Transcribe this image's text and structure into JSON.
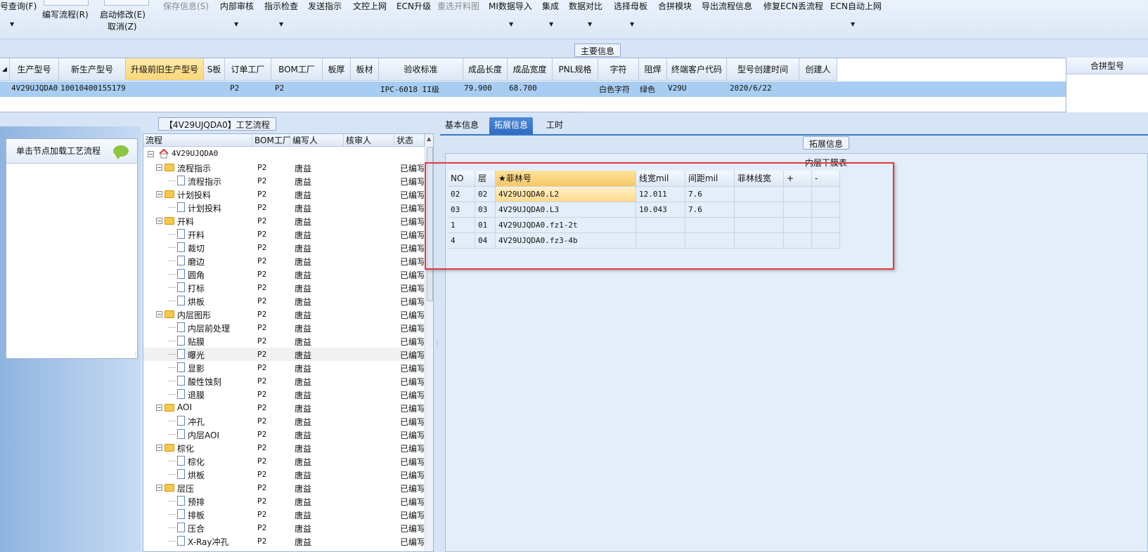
{
  "toolbar": {
    "query": "号查询(F)",
    "write_flow": "编写流程(R)",
    "start_modify": "启动修改(E)",
    "cancel": "取消(Z)",
    "save": "保存信息(S)",
    "internal_review": "内部审核",
    "instruction_check": "指示检查",
    "send_instruction": "发送指示",
    "doc_upload": "文控上网",
    "ecn_upgrade": "ECN升级",
    "reselect": "重选开料图",
    "mi_import": "MI数据导入",
    "integrate": "集成",
    "data_compare": "数据对比",
    "select_motherboard": "选择母板",
    "merge_module": "合拼模块",
    "export_flow": "导出流程信息",
    "fix_ecn": "修复ECN丢流程",
    "ecn_auto": "ECN自动上网"
  },
  "main_info": {
    "title": "主要信息",
    "headers": [
      "生产型号",
      "新生产型号",
      "升级前旧生产型号",
      "S板",
      "订单工厂",
      "BOM工厂",
      "板厚",
      "板材",
      "验收标准",
      "成品长度",
      "成品宽度",
      "PNL规格",
      "字符",
      "阻焊",
      "终端客户代码",
      "型号创建时间",
      "创建人"
    ],
    "row": {
      "prod_model": "4V29UJQDA0",
      "new_prod_model": "10010400155179",
      "order_factory": "P2",
      "bom_factory": "P2",
      "standard": "IPC-6018 II级",
      "length": "79.900",
      "width": "68.700",
      "char": "白色字符",
      "solder": "绿色",
      "customer": "V29U",
      "created": "2020/6/22"
    },
    "merge_header": "合拼型号"
  },
  "left_panel": {
    "hint": "单击节点加载工艺流程"
  },
  "flow": {
    "title": "【4V29UJQDA0】工艺流程",
    "headers": {
      "name": "流程",
      "bom": "BOM工厂",
      "writer": "编写人",
      "reviewer": "核审人",
      "status": "状态"
    },
    "root": "4V29UJQDA0",
    "rows": [
      {
        "name": "流程指示",
        "type": "folder",
        "bom": "P2",
        "writer": "唐益",
        "status": "已编写"
      },
      {
        "name": "流程指示",
        "type": "doc",
        "bom": "P2",
        "writer": "唐益",
        "status": "已编写"
      },
      {
        "name": "计划投料",
        "type": "folder",
        "bom": "P2",
        "writer": "唐益",
        "status": "已编写"
      },
      {
        "name": "计划投料",
        "type": "doc",
        "bom": "P2",
        "writer": "唐益",
        "status": "已编写"
      },
      {
        "name": "开料",
        "type": "folder",
        "bom": "P2",
        "writer": "唐益",
        "status": "已编写"
      },
      {
        "name": "开料",
        "type": "doc",
        "bom": "P2",
        "writer": "唐益",
        "status": "已编写"
      },
      {
        "name": "裁切",
        "type": "doc",
        "bom": "P2",
        "writer": "唐益",
        "status": "已编写"
      },
      {
        "name": "磨边",
        "type": "doc",
        "bom": "P2",
        "writer": "唐益",
        "status": "已编写"
      },
      {
        "name": "圆角",
        "type": "doc",
        "bom": "P2",
        "writer": "唐益",
        "status": "已编写"
      },
      {
        "name": "打标",
        "type": "doc",
        "bom": "P2",
        "writer": "唐益",
        "status": "已编写"
      },
      {
        "name": "烘板",
        "type": "doc",
        "bom": "P2",
        "writer": "唐益",
        "status": "已编写"
      },
      {
        "name": "内层图形",
        "type": "folder",
        "bom": "P2",
        "writer": "唐益",
        "status": "已编写"
      },
      {
        "name": "内层前处理",
        "type": "doc",
        "bom": "P2",
        "writer": "唐益",
        "status": "已编写"
      },
      {
        "name": "贴膜",
        "type": "doc",
        "bom": "P2",
        "writer": "唐益",
        "status": "已编写"
      },
      {
        "name": "曝光",
        "type": "doc",
        "bom": "P2",
        "writer": "唐益",
        "status": "已编写",
        "selected": true
      },
      {
        "name": "显影",
        "type": "doc",
        "bom": "P2",
        "writer": "唐益",
        "status": "已编写"
      },
      {
        "name": "酸性蚀刻",
        "type": "doc",
        "bom": "P2",
        "writer": "唐益",
        "status": "已编写"
      },
      {
        "name": "退膜",
        "type": "doc",
        "bom": "P2",
        "writer": "唐益",
        "status": "已编写"
      },
      {
        "name": "AOI",
        "type": "folder",
        "bom": "P2",
        "writer": "唐益",
        "status": "已编写"
      },
      {
        "name": "冲孔",
        "type": "doc",
        "bom": "P2",
        "writer": "唐益",
        "status": "已编写"
      },
      {
        "name": "内层AOI",
        "type": "doc",
        "bom": "P2",
        "writer": "唐益",
        "status": "已编写"
      },
      {
        "name": "棕化",
        "type": "folder",
        "bom": "P2",
        "writer": "唐益",
        "status": "已编写"
      },
      {
        "name": "棕化",
        "type": "doc",
        "bom": "P2",
        "writer": "唐益",
        "status": "已编写"
      },
      {
        "name": "烘板",
        "type": "doc",
        "bom": "P2",
        "writer": "唐益",
        "status": "已编写"
      },
      {
        "name": "层压",
        "type": "folder",
        "bom": "P2",
        "writer": "唐益",
        "status": "已编写"
      },
      {
        "name": "预排",
        "type": "doc",
        "bom": "P2",
        "writer": "唐益",
        "status": "已编写"
      },
      {
        "name": "排板",
        "type": "doc",
        "bom": "P2",
        "writer": "唐益",
        "status": "已编写"
      },
      {
        "name": "压合",
        "type": "doc",
        "bom": "P2",
        "writer": "唐益",
        "status": "已编写"
      },
      {
        "name": "X-Ray冲孔",
        "type": "doc",
        "bom": "P2",
        "writer": "唐益",
        "status": "已编写"
      }
    ]
  },
  "tabs": [
    "基本信息",
    "拓展信息",
    "工时"
  ],
  "ext_info": {
    "title": "拓展信息",
    "table_title": "内层干膜表",
    "headers": [
      "NO",
      "层",
      "★菲林号",
      "线宽mil",
      "间距mil",
      "菲林线宽",
      "+",
      "-"
    ],
    "rows": [
      [
        "02",
        "02",
        "4V29UJQDA0.L2",
        "12.011",
        "7.6",
        "",
        "",
        ""
      ],
      [
        "03",
        "03",
        "4V29UJQDA0.L3",
        "10.043",
        "7.6",
        "",
        "",
        ""
      ],
      [
        "1",
        "01",
        "4V29UJQDA0.fz1-2t",
        "",
        "",
        "",
        "",
        ""
      ],
      [
        "4",
        "04",
        "4V29UJQDA0.fz3-4b",
        "",
        "",
        "",
        "",
        ""
      ]
    ]
  }
}
